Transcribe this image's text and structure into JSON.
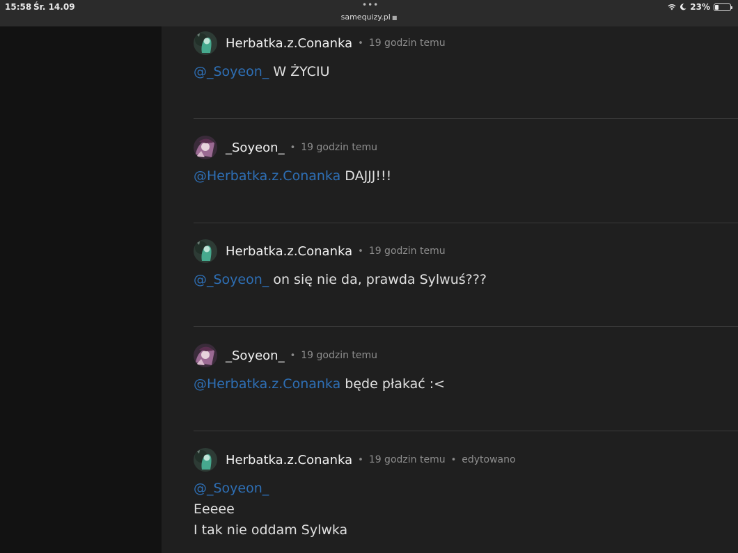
{
  "status_bar": {
    "time": "15:58",
    "date": "Śr. 14.09",
    "url": "samequizy.pl",
    "battery": "23%"
  },
  "comments": [
    {
      "author": "Herbatka.z.Conanka",
      "time": "19 godzin temu",
      "mention": "@_Soyeon_",
      "text": "W ŻYCIU"
    },
    {
      "author": "_Soyeon_",
      "time": "19 godzin temu",
      "mention": "@Herbatka.z.Conanka",
      "text": "DAJJJ!!!"
    },
    {
      "author": "Herbatka.z.Conanka",
      "time": "19 godzin temu",
      "mention": "@_Soyeon_",
      "text": "on się nie da, prawda Sylwuś???"
    },
    {
      "author": "_Soyeon_",
      "time": "19 godzin temu",
      "mention": "@Herbatka.z.Conanka",
      "text": "będe płakać :<"
    },
    {
      "author": "Herbatka.z.Conanka",
      "time": "19 godzin temu",
      "edited": "edytowano",
      "mention": "@_Soyeon_",
      "lines": [
        "Eeeee",
        "I tak nie oddam Sylwka"
      ]
    }
  ],
  "colors": {
    "mention": "#2e6fb5",
    "background": "#1f1f1f",
    "sidebar": "#121212"
  }
}
